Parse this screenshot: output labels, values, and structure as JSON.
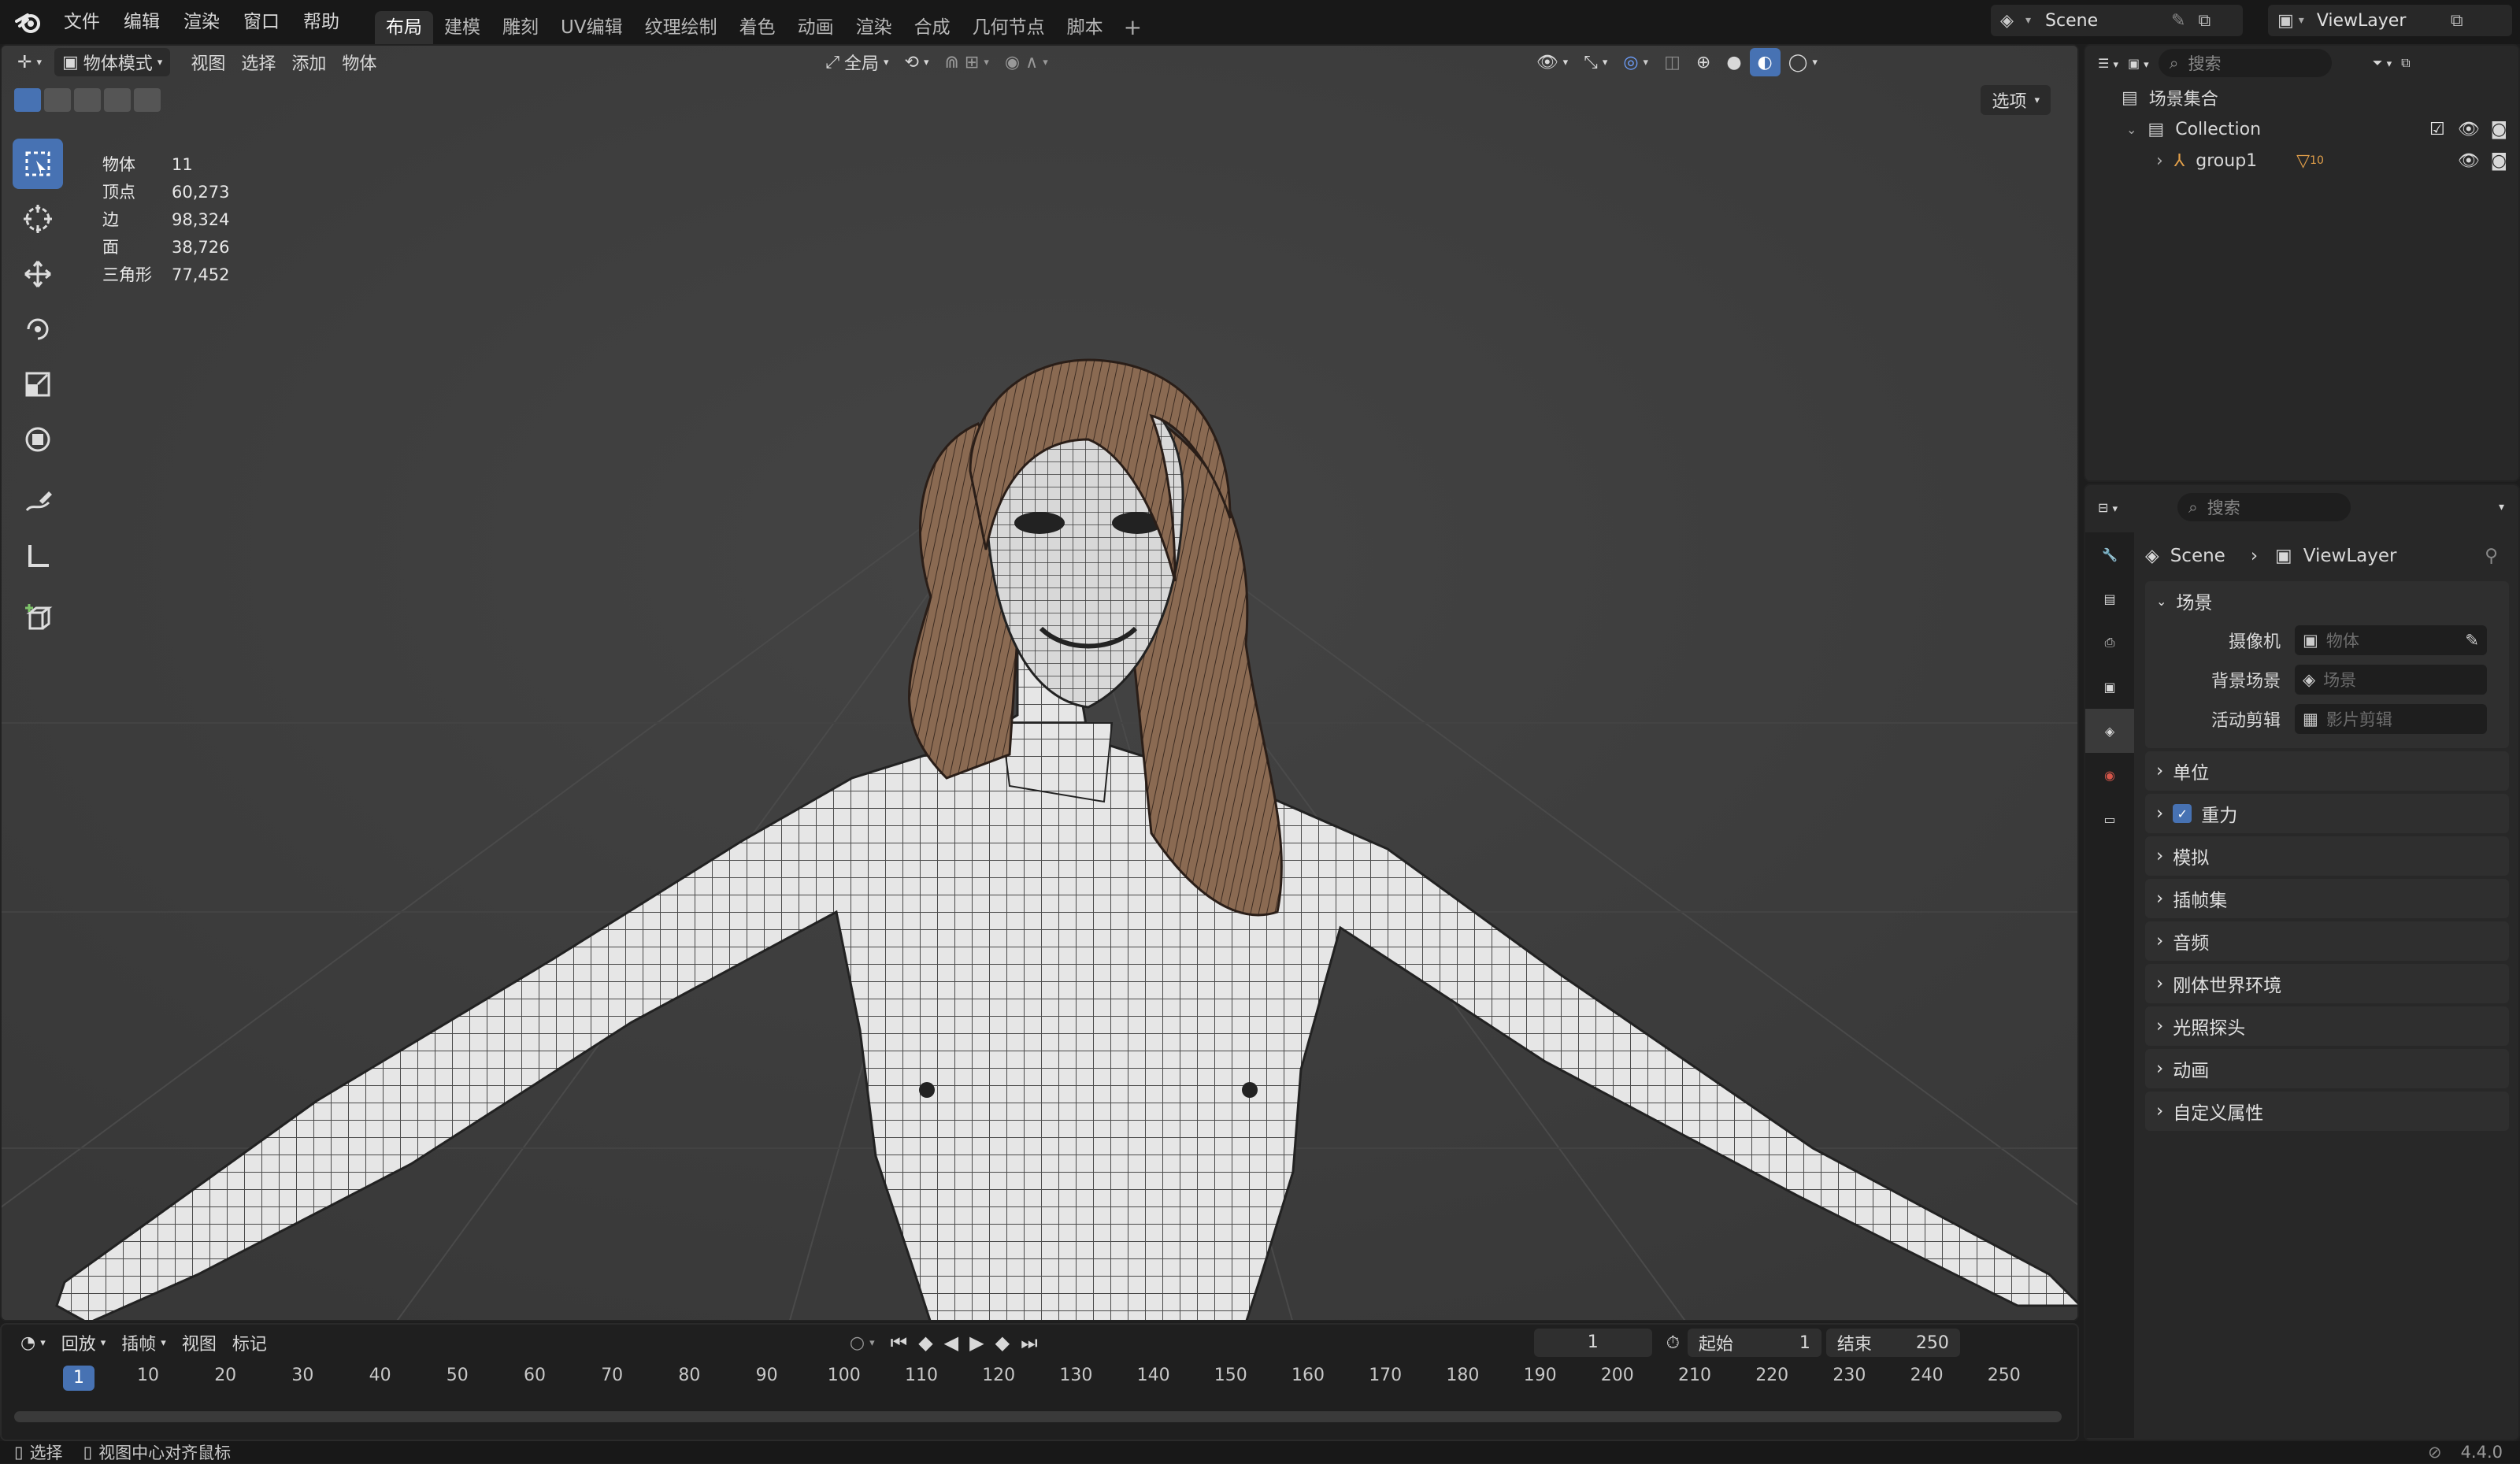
{
  "menu": [
    "文件",
    "编辑",
    "渲染",
    "窗口",
    "帮助"
  ],
  "workspaces": [
    "布局",
    "建模",
    "雕刻",
    "UV编辑",
    "纹理绘制",
    "着色",
    "动画",
    "渲染",
    "合成",
    "几何节点",
    "脚本"
  ],
  "active_workspace": "布局",
  "add_workspace": "+",
  "scene": {
    "name": "Scene"
  },
  "view_layer": {
    "name": "ViewLayer"
  },
  "viewport": {
    "mode": "物体模式",
    "menus": [
      "视图",
      "选择",
      "添加",
      "物体"
    ],
    "transform_orientation": "全局",
    "options_label": "选项",
    "stats": [
      {
        "label": "物体",
        "value": "11"
      },
      {
        "label": "顶点",
        "value": "60,273"
      },
      {
        "label": "边",
        "value": "98,324"
      },
      {
        "label": "面",
        "value": "38,726"
      },
      {
        "label": "三角形",
        "value": "77,452"
      }
    ]
  },
  "tools": [
    "select-box-icon",
    "cursor-icon",
    "move-icon",
    "rotate-icon",
    "scale-icon",
    "transform-icon",
    "annotate-icon",
    "measure-icon",
    "add-cube-icon"
  ],
  "timeline": {
    "menus": [
      "回放",
      "插帧",
      "视图",
      "标记"
    ],
    "current_frame": "1",
    "start_label": "起始",
    "start_value": "1",
    "end_label": "结束",
    "end_value": "250",
    "ruler": [
      "1",
      "10",
      "20",
      "30",
      "40",
      "50",
      "60",
      "70",
      "80",
      "90",
      "100",
      "110",
      "120",
      "130",
      "140",
      "150",
      "160",
      "170",
      "180",
      "190",
      "200",
      "210",
      "220",
      "230",
      "240",
      "250"
    ]
  },
  "outliner": {
    "search_placeholder": "搜索",
    "scene_collection": "场景集合",
    "collection": "Collection",
    "group": "group1",
    "group_badge": "10"
  },
  "properties": {
    "search_placeholder": "搜索",
    "breadcrumb_scene": "Scene",
    "breadcrumb_viewlayer": "ViewLayer",
    "scene_panel": "场景",
    "camera_label": "摄像机",
    "camera_placeholder": "物体",
    "bg_scene_label": "背景场景",
    "bg_scene_placeholder": "场景",
    "active_clip_label": "活动剪辑",
    "active_clip_placeholder": "影片剪辑",
    "panels": [
      "单位",
      "重力",
      "模拟",
      "插帧集",
      "音频",
      "刚体世界环境",
      "光照探头",
      "动画",
      "自定义属性"
    ]
  },
  "status": {
    "select": "选择",
    "center_view": "视图中心对齐鼠标",
    "version": "4.4.0"
  }
}
